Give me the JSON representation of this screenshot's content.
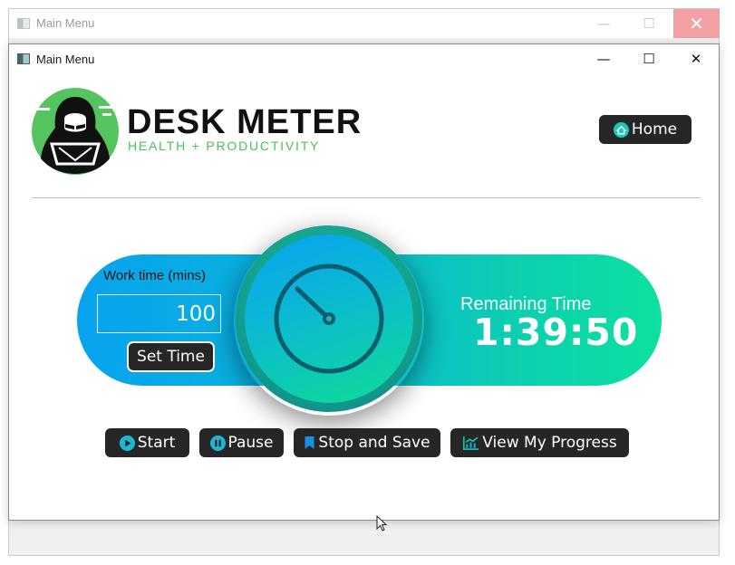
{
  "background_window": {
    "title": "Main Menu",
    "controls": {
      "minimize": "—",
      "maximize": "☐",
      "close": "✕"
    }
  },
  "window": {
    "title": "Main Menu",
    "controls": {
      "minimize": "—",
      "maximize": "☐",
      "close": "✕"
    }
  },
  "header": {
    "brand_name": "DESK METER",
    "brand_tagline": "HEALTH + PRODUCTIVITY",
    "home_label": "Home",
    "home_icon": "home-icon"
  },
  "timer": {
    "work_time_label": "Work time (mins)",
    "work_time_value": "100",
    "set_time_label": "Set Time",
    "remaining_label": "Remaining Time",
    "remaining_value": "1:39:50",
    "dial_icon": "clock-dial-icon"
  },
  "actions": {
    "start_label": "Start",
    "start_icon": "play-icon",
    "pause_label": "Pause",
    "pause_icon": "pause-icon",
    "stop_label": "Stop and Save",
    "stop_icon": "bookmark-icon",
    "progress_label": "View My Progress",
    "progress_icon": "chart-icon"
  },
  "colors": {
    "accent_blue": "#08a3ee",
    "accent_green": "#0de0a0",
    "brand_green": "#4fbf5a",
    "button_dark": "#262626"
  }
}
